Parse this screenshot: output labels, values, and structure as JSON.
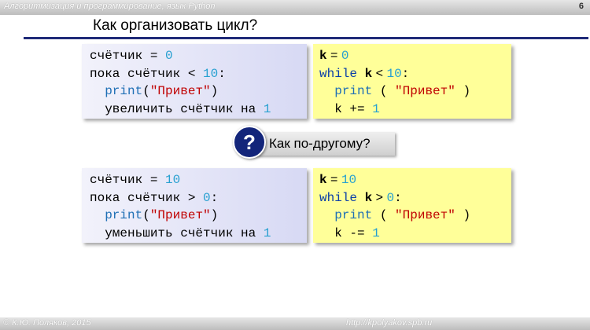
{
  "header": {
    "course": "Алгоритмизация и программирование, язык Python",
    "page": "6"
  },
  "title": "Как организовать цикл?",
  "block1": {
    "pseudo": {
      "l1a": "счётчик = ",
      "l1n": "0",
      "l2a": "пока счётчик < ",
      "l2n": "10",
      "l2b": ":",
      "l3a": "  ",
      "l3p": "print",
      "l3b": "(",
      "l3s": "\"Привет\"",
      "l3c": ")",
      "l4a": "  увеличить счётчик на ",
      "l4n": "1"
    },
    "python": {
      "l1k": "k",
      "l1eq": " = ",
      "l1n": "0",
      "l2w": "while",
      "l2sp": " ",
      "l2k": "k",
      "l2lt": " < ",
      "l2n": "10",
      "l2c": ":",
      "l3a": "  ",
      "l3p": "print",
      "l3b": " ( ",
      "l3s": "\"Привет\"",
      "l3c": " )",
      "l4a": "  k += ",
      "l4n": "1"
    }
  },
  "question": {
    "icon": "?",
    "label": "Как по-другому?"
  },
  "block2": {
    "pseudo": {
      "l1a": "счётчик = ",
      "l1n": "10",
      "l2a": "пока счётчик > ",
      "l2n": "0",
      "l2b": ":",
      "l3a": "  ",
      "l3p": "print",
      "l3b": "(",
      "l3s": "\"Привет\"",
      "l3c": ")",
      "l4a": "  уменьшить счётчик на ",
      "l4n": "1"
    },
    "python": {
      "l1k": "k",
      "l1eq": " = ",
      "l1n": "10",
      "l2w": "while",
      "l2sp": " ",
      "l2k": "k",
      "l2gt": " > ",
      "l2n": "0",
      "l2c": ":",
      "l3a": "  ",
      "l3p": "print",
      "l3b": " ( ",
      "l3s": "\"Привет\"",
      "l3c": " )",
      "l4a": "  k -= ",
      "l4n": "1"
    }
  },
  "footer": {
    "author": "© К.Ю. Поляков, 2015",
    "site": "http://kpolyakov.spb.ru"
  }
}
